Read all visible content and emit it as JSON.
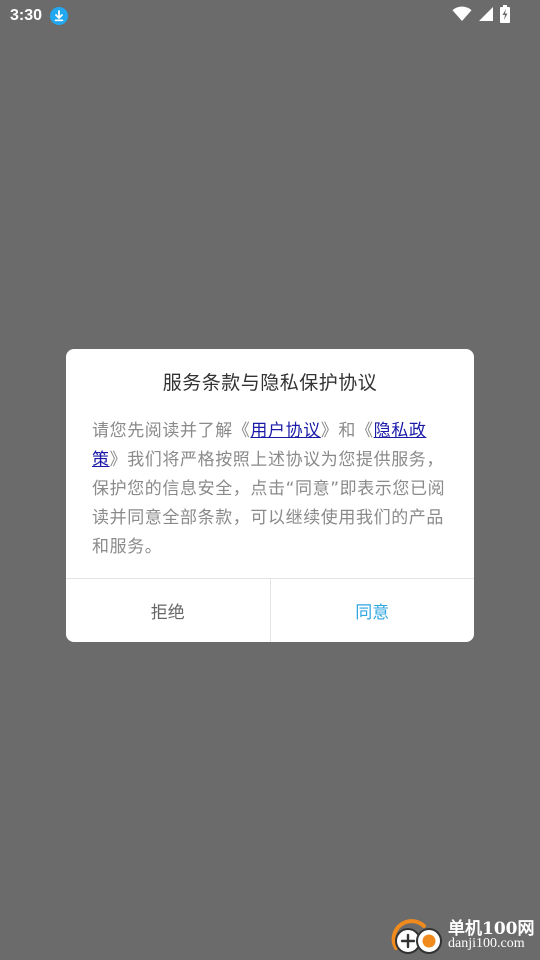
{
  "status_bar": {
    "time": "3:30",
    "icons": [
      "download-icon",
      "wifi-icon",
      "signal-icon",
      "battery-charging-icon"
    ],
    "download_badge_color": "#22a8f0"
  },
  "dialog": {
    "title": "服务条款与隐私保护协议",
    "body": {
      "part1": "请您先阅读并了解《",
      "link_user_agreement": "用户协议",
      "part2": "》和《",
      "link_privacy_policy": "隐私政策",
      "part3": "》我们将严格按照上述协议为您提供服务，保护您的信息安全，点击“同意”即表示您已阅读并同意全部条款，可以继续使用我们的产品和服务。"
    },
    "reject_label": "拒绝",
    "agree_label": "同意"
  },
  "watermark": {
    "brand": "单机100网",
    "domain": "danji100.com"
  },
  "colors": {
    "backdrop": "#6b6b6b",
    "link": "#1a1aa8",
    "agree": "#2ea6e0",
    "body_text": "#8a8a8a"
  }
}
